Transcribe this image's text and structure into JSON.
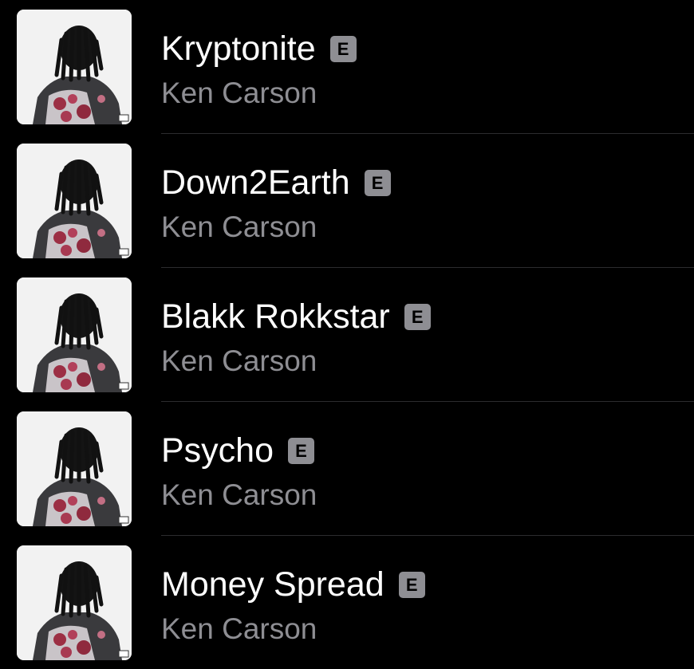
{
  "songs": [
    {
      "title": "Kryptonite",
      "artist": "Ken Carson",
      "explicit": "E"
    },
    {
      "title": "Down2Earth",
      "artist": "Ken Carson",
      "explicit": "E"
    },
    {
      "title": "Blakk Rokkstar",
      "artist": "Ken Carson",
      "explicit": "E"
    },
    {
      "title": "Psycho",
      "artist": "Ken Carson",
      "explicit": "E"
    },
    {
      "title": "Money Spread",
      "artist": "Ken Carson",
      "explicit": "E"
    }
  ],
  "colors": {
    "background": "#000000",
    "title": "#ffffff",
    "artist": "#8e8e93",
    "explicit_badge": "#8e8e93",
    "divider": "#2c2c2e"
  }
}
